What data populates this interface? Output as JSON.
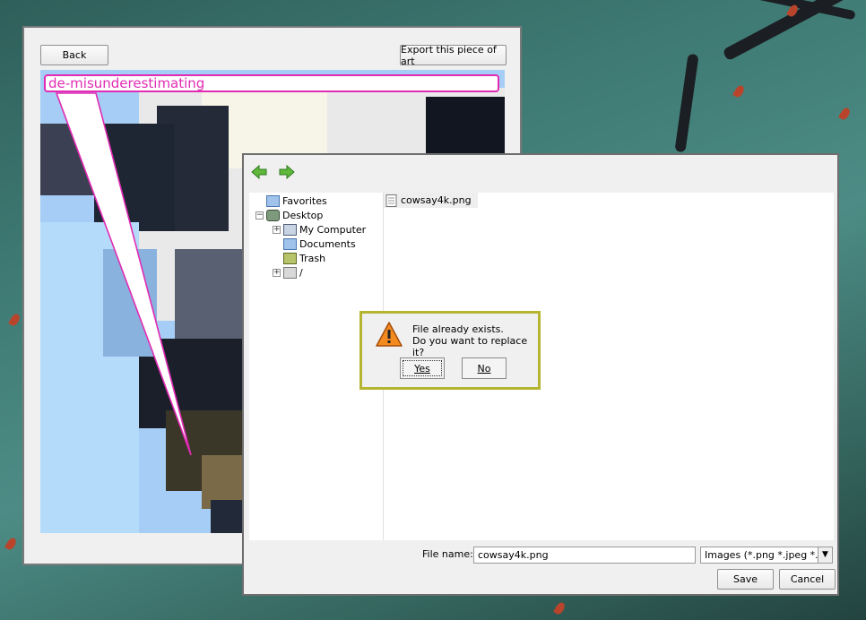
{
  "art_window": {
    "back_label": "Back",
    "export_label": "Export this piece of art",
    "caption_text": "de-misunderestimating"
  },
  "save_dialog": {
    "tree": {
      "favorites": "Favorites",
      "desktop": "Desktop",
      "my_computer": "My Computer",
      "documents": "Documents",
      "trash": "Trash",
      "root": "/"
    },
    "file_list": [
      "cowsay4k.png"
    ],
    "file_name_label": "File name:",
    "file_name_value": "cowsay4k.png",
    "file_type_value": "Images (*.png *.jpeg *.jp",
    "save_label": "Save",
    "cancel_label": "Cancel"
  },
  "alert": {
    "line1": "File already exists.",
    "line2": "Do you want to replace it?",
    "yes_label": "Yes",
    "no_label": "No",
    "colors": {
      "border": "#b5b531",
      "warning": "#f28a1f"
    }
  },
  "colors": {
    "caption_accent": "#e12bb4"
  }
}
